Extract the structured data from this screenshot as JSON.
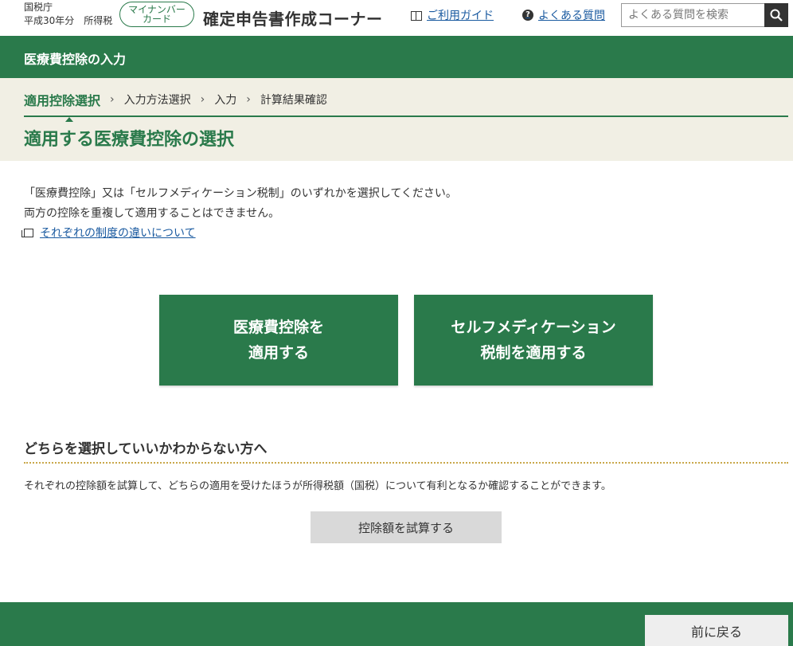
{
  "header": {
    "agency": "国税庁",
    "tax_year": "平成30年分　所得税",
    "mynumber_line1": "マイナンバー",
    "mynumber_line2": "カード",
    "site_title": "確定申告書作成コーナー",
    "guide_label": "ご利用ガイド",
    "faq_label": "よくある質問",
    "search_placeholder": "よくある質問を検索"
  },
  "section": {
    "title": "医療費控除の入力"
  },
  "steps": [
    {
      "label": "適用控除選択",
      "active": true
    },
    {
      "label": "入力方法選択",
      "active": false
    },
    {
      "label": "入力",
      "active": false
    },
    {
      "label": "計算結果確認",
      "active": false
    }
  ],
  "page_title": "適用する医療費控除の選択",
  "intro": {
    "line1": "「医療費控除」又は「セルフメディケーション税制」のいずれかを選択してください。",
    "line2": "両方の控除を重複して適用することはできません。",
    "diff_link": "それぞれの制度の違いについて"
  },
  "choices": {
    "medical_line1": "医療費控除を",
    "medical_line2": "適用する",
    "self_line1": "セルフメディケーション",
    "self_line2": "税制を適用する"
  },
  "help": {
    "heading": "どちらを選択していいかわからない方へ",
    "text": "それぞれの控除額を試算して、どちらの適用を受けたほうが所得税額（国税）について有利となるか確認することができます。",
    "trial_button": "控除額を試算する"
  },
  "footer": {
    "back_button": "前に戻る"
  },
  "colors": {
    "primary_green": "#2a7a4b",
    "steps_bg": "#f1efe4",
    "link_blue": "#1a5aa0"
  }
}
